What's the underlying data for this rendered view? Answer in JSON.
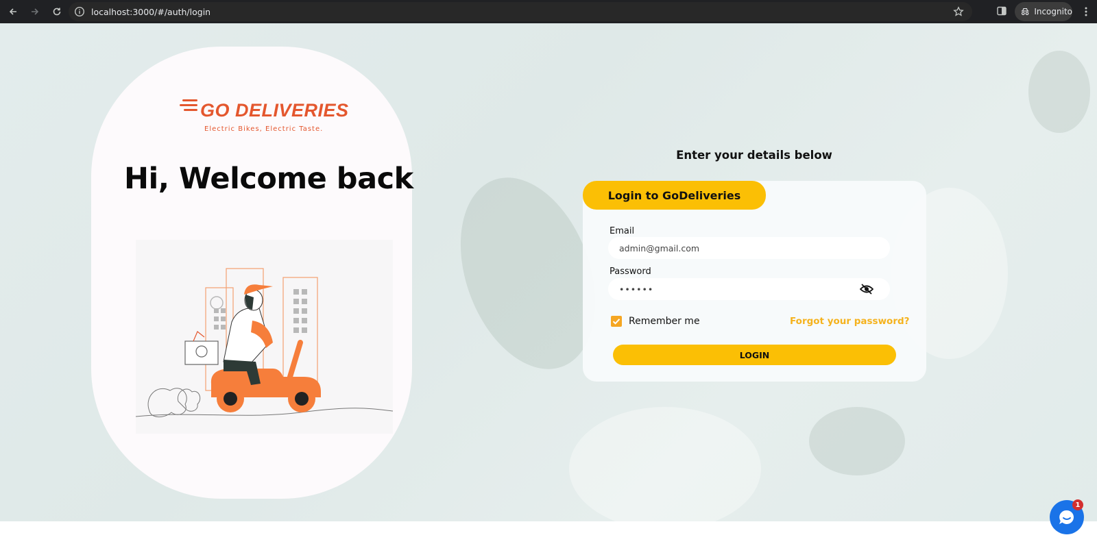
{
  "browser": {
    "url": "localhost:3000/#/auth/login",
    "profile_label": "Incognito"
  },
  "brand": {
    "name": "GO DELIVERIES",
    "tagline": "Electric Bikes, Electric Taste.",
    "accent": "#e4572e"
  },
  "welcome": {
    "title": "Hi, Welcome back"
  },
  "form": {
    "heading": "Enter your details below",
    "tab_label": "Login to GoDeliveries",
    "email_label": "Email",
    "email_value": "admin@gmail.com",
    "password_label": "Password",
    "password_value": "••••••",
    "remember_label": "Remember me",
    "remember_checked": true,
    "forgot_label": "Forgot your password?",
    "submit_label": "LOGIN",
    "accent": "#fbbf05"
  },
  "chat": {
    "badge_count": "1"
  }
}
